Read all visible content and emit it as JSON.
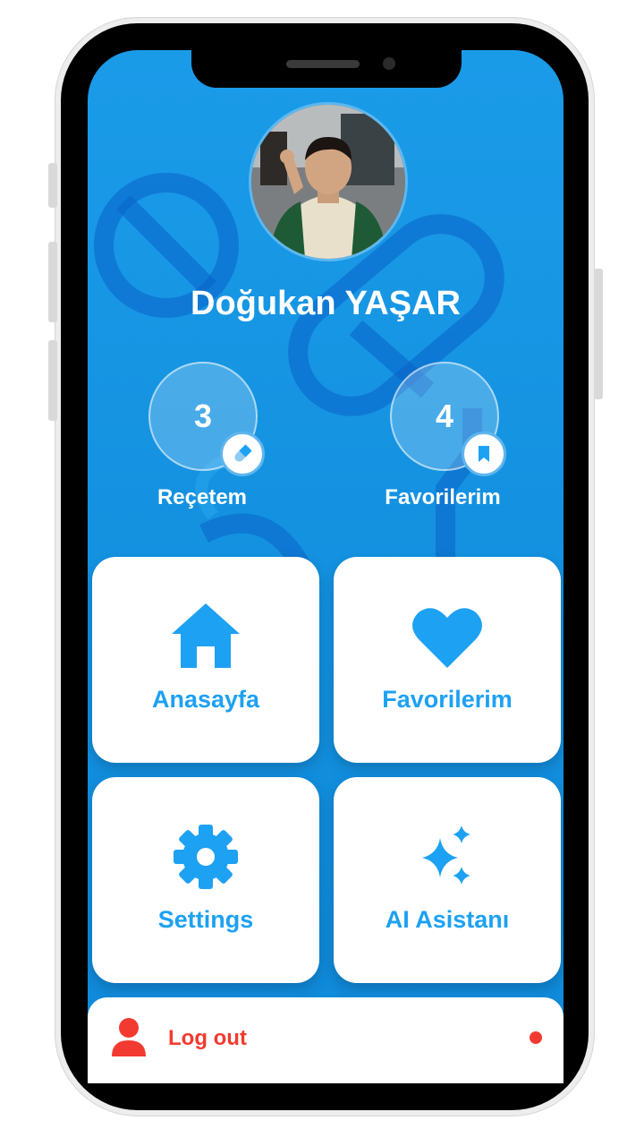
{
  "profile": {
    "name": "Doğukan YAŞAR"
  },
  "stats": [
    {
      "value": "3",
      "label": "Reçetem",
      "icon": "pill-icon"
    },
    {
      "value": "4",
      "label": "Favorilerim",
      "icon": "bookmark-icon"
    }
  ],
  "menu": [
    {
      "label": "Anasayfa",
      "icon": "home-icon"
    },
    {
      "label": "Favorilerim",
      "icon": "heart-icon"
    },
    {
      "label": "Settings",
      "icon": "gear-icon"
    },
    {
      "label": "AI Asistanı",
      "icon": "sparkle-icon"
    }
  ],
  "logout": {
    "label": "Log out",
    "icon": "person-icon"
  },
  "colors": {
    "background_blue": "#1a9be8",
    "accent_blue": "#1da1f2",
    "logout_red": "#f33a30",
    "card_white": "#ffffff"
  }
}
